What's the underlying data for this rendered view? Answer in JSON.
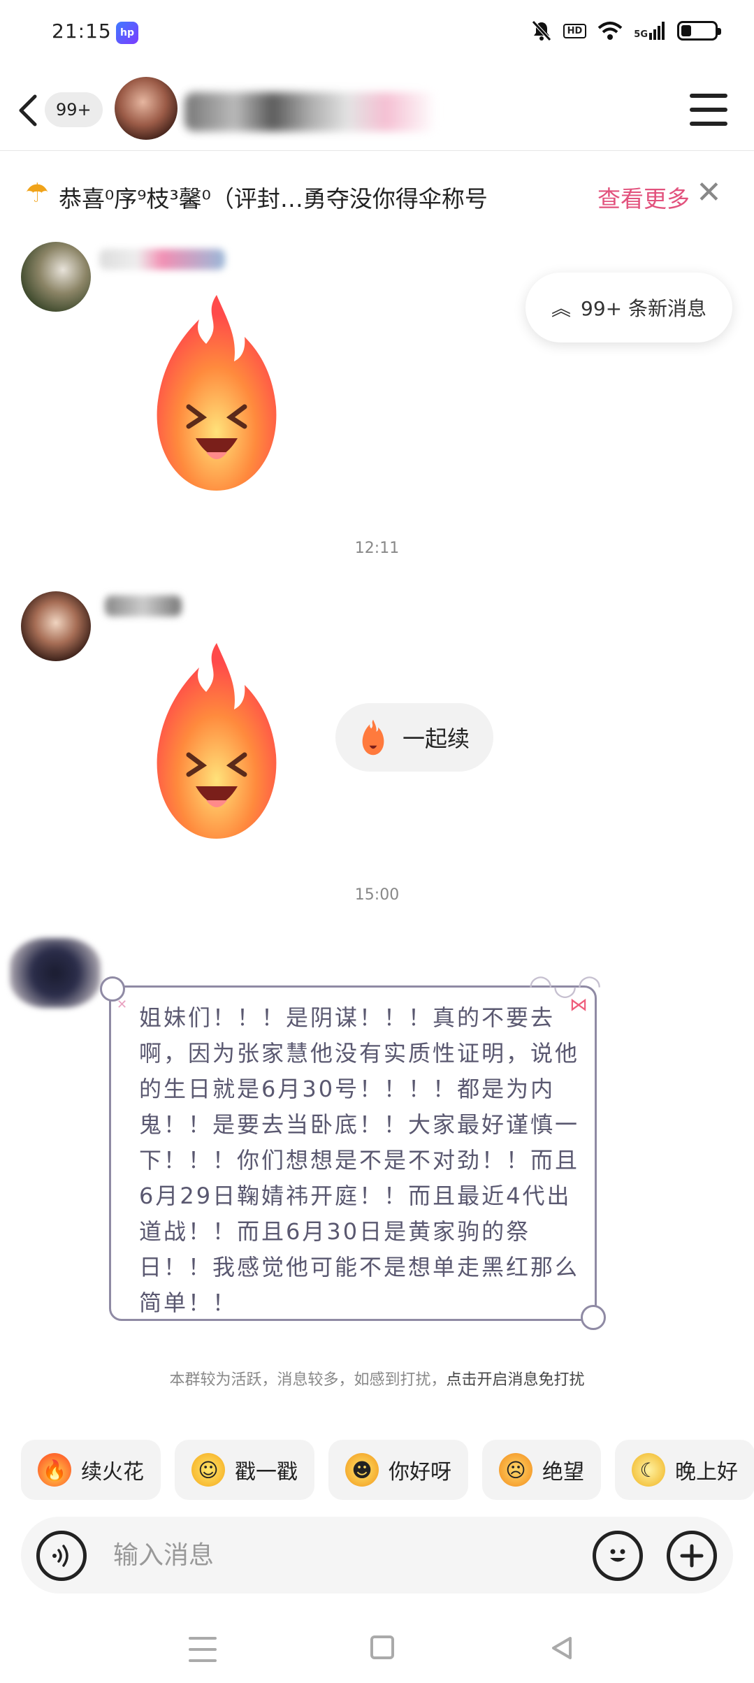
{
  "status_bar": {
    "time": "21:15",
    "app_badge": "hp",
    "hd_label": "HD",
    "network_label": "5G",
    "battery_level": 0.3
  },
  "header": {
    "unread_count": "99+"
  },
  "notice": {
    "text": "恭喜⁰序⁹枝³馨⁰（评封…勇夺没你得伞称号",
    "more_label": "查看更多",
    "close_icon": "close-icon"
  },
  "new_messages": {
    "label": "99+ 条新消息",
    "icon": "chevron-double-up-icon"
  },
  "timestamps": [
    "12:11",
    "15:00"
  ],
  "reply_chip": {
    "label": "一起续"
  },
  "letter": {
    "text": "姐妹们！！！是阴谋！！！真的不要去啊，因为张家慧他没有实质性证明，说他的生日就是6月30号！！！！都是为内鬼！！是要去当卧底！！大家最好谨慎一下！！！你们想想是不是不对劲！！而且6月29日鞠婧祎开庭！！而且最近4代出道战！！而且6月30日是黄家驹的祭日！！我感觉他可能不是想单走黑红那么简单！！"
  },
  "group_tip": {
    "text": "本群较为活跃，消息较多，如感到打扰，",
    "link": "点击开启消息免打扰"
  },
  "quick_replies": [
    {
      "label": "续火花",
      "icon": "fire-emoji-icon"
    },
    {
      "label": "戳一戳",
      "icon": "poke-emoji-icon"
    },
    {
      "label": "你好呀",
      "icon": "hello-emoji-icon"
    },
    {
      "label": "绝望",
      "icon": "despair-emoji-icon"
    },
    {
      "label": "晚上好",
      "icon": "good-night-emoji-icon"
    }
  ],
  "input": {
    "placeholder": "输入消息"
  },
  "colors": {
    "accent_pink": "#e2527d",
    "letter_border": "#8f8aa4",
    "letter_text": "#5a5870"
  }
}
